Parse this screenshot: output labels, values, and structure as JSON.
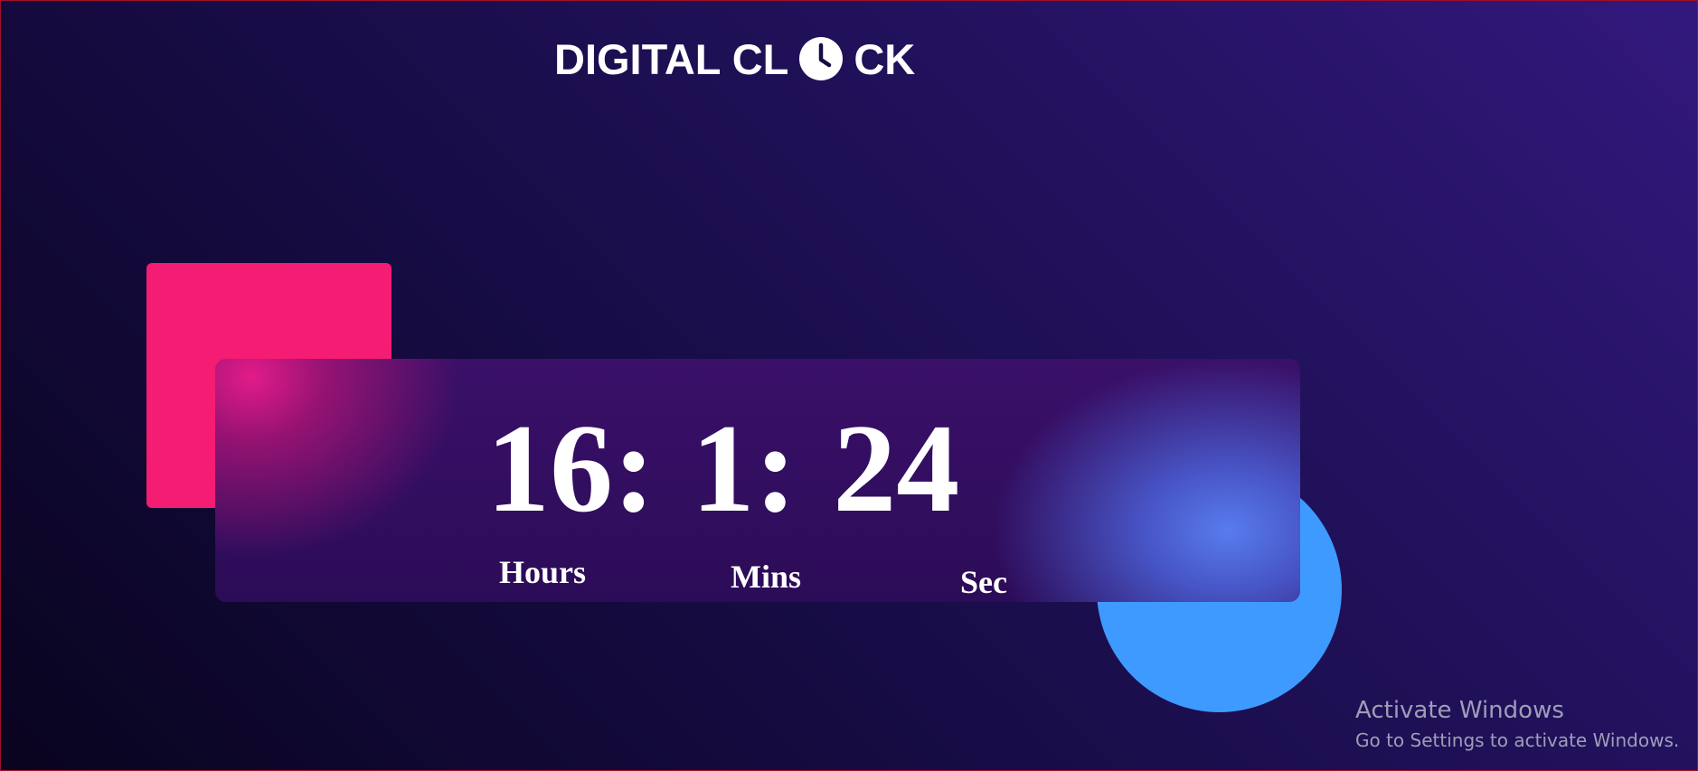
{
  "header": {
    "title_left": "DIGITAL CL",
    "title_right": "CK",
    "icon": "clock-icon"
  },
  "clock": {
    "hours": "16",
    "minutes": "1",
    "seconds": "24",
    "separator": ":",
    "labels": {
      "hours": "Hours",
      "mins": "Mins",
      "sec": "Sec"
    }
  },
  "decorations": {
    "square_color": "#f41c73",
    "circle_color": "#3e9aff"
  },
  "watermark": {
    "title": "Activate Windows",
    "subtitle": "Go to Settings to activate Windows."
  }
}
